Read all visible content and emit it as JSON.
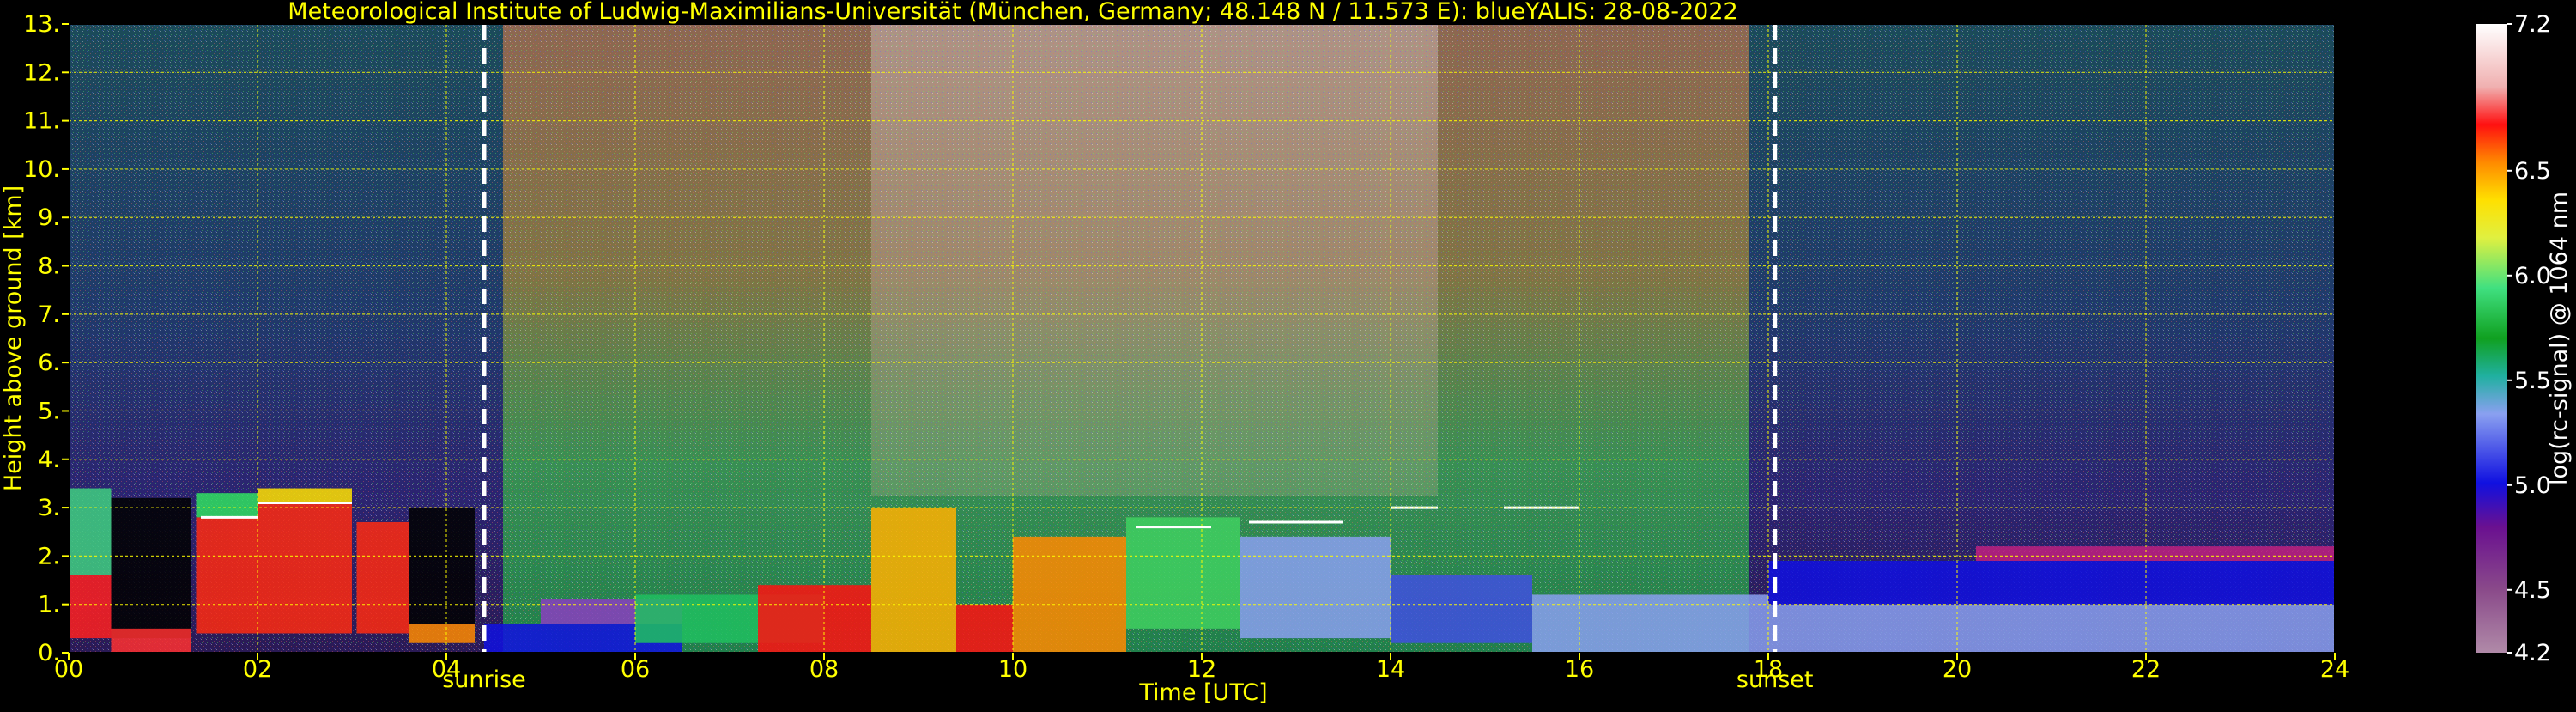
{
  "chart_data": {
    "type": "heatmap",
    "title": "Meteorological Institute of Ludwig-Maximilians-Universität (München, Germany; 48.148 N / 11.573 E):    blueYALIS: 28-08-2022",
    "xlabel": "Time [UTC]",
    "ylabel": "Height above ground [km]",
    "xlim": [
      0,
      24
    ],
    "ylim": [
      0,
      13
    ],
    "x_ticks": [
      "00",
      "02",
      "04",
      "06",
      "08",
      "10",
      "12",
      "14",
      "16",
      "18",
      "20",
      "22",
      "24"
    ],
    "y_ticks": [
      "0.",
      "1.",
      "2.",
      "3.",
      "4.",
      "5.",
      "6.",
      "7.",
      "8.",
      "9.",
      "10.",
      "11.",
      "12.",
      "13."
    ],
    "grid": true,
    "grid_color": "#ffff00",
    "annotations": [
      {
        "label": "sunrise",
        "x": 4.4
      },
      {
        "label": "sunset",
        "x": 18.07
      }
    ],
    "colorbar": {
      "label": "log(rc-signal) @ 1064 nm",
      "range": [
        4.2,
        7.2
      ],
      "ticks": [
        "4.2",
        "4.5",
        "5.0",
        "5.5",
        "6.0",
        "6.5",
        "7.2"
      ]
    },
    "colors": {
      "text": "#ffff00",
      "background": "#000000",
      "marker_line": "#ffffff"
    }
  }
}
